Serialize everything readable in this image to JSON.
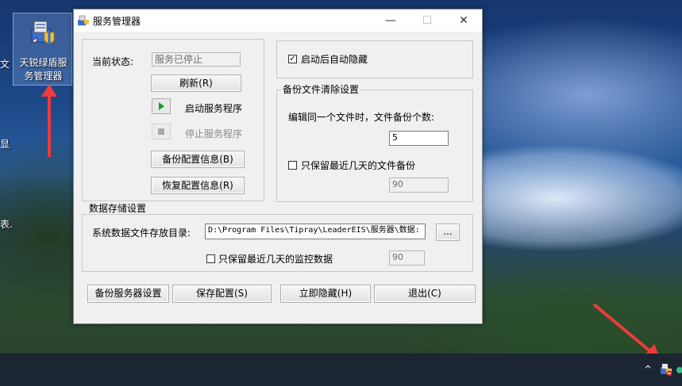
{
  "desktop": {
    "icon_label": "天锐绿盾服务管理器",
    "edge_texts": [
      "文",
      "显",
      "表."
    ]
  },
  "window": {
    "title": "服务管理器",
    "status_label": "当前状态:",
    "status_value": "服务已停止",
    "refresh_button": "刷新(R)",
    "start_label": "启动服务程序",
    "stop_label": "停止服务程序",
    "backup_config_button": "备份配置信息(B)",
    "restore_config_button": "恢复配置信息(R)",
    "auto_hide_label": "启动后自动隐藏",
    "auto_hide_checked": true,
    "backup_cleanup": {
      "title": "备份文件清除设置",
      "count_label": "编辑同一个文件时，文件备份个数:",
      "count_value": "5",
      "keep_days_label": "只保留最近几天的文件备份",
      "keep_days_value": "90"
    },
    "data_storage": {
      "title": "数据存储设置",
      "dir_label": "系统数据文件存放目录:",
      "dir_value": "D:\\Program Files\\Tipray\\LeaderEIS\\服务器\\数据:",
      "browse_button": "...",
      "keep_monitor_label": "只保留最近几天的监控数据",
      "keep_monitor_value": "90"
    },
    "bottom_buttons": {
      "backup_server": "备份服务器设置",
      "save": "保存配置(S)",
      "hide": "立即隐藏(H)",
      "exit": "退出(C)"
    }
  }
}
